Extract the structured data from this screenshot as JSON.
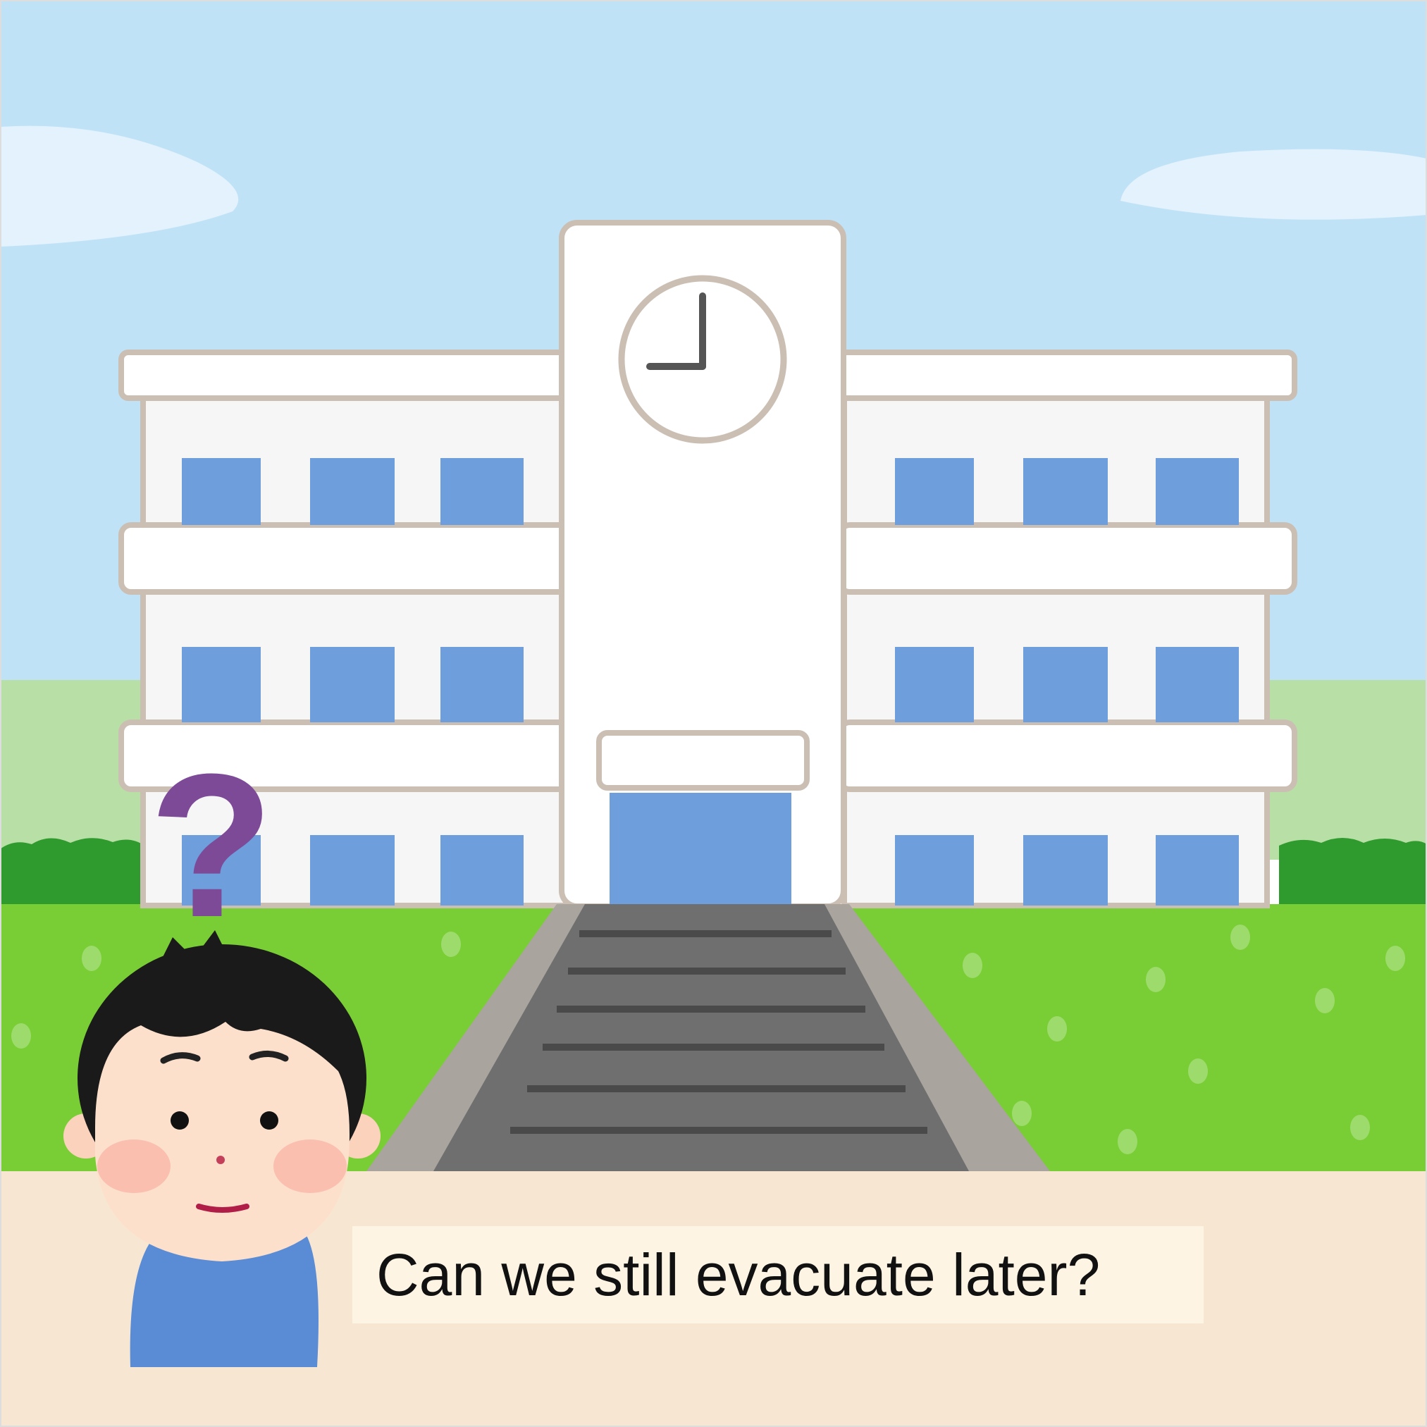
{
  "caption": {
    "text": "Can we still evacuate later?"
  },
  "scene": {
    "building": "school building with clock tower",
    "clock": {
      "hour": 9,
      "minute": 0
    },
    "character": "boy with question mark",
    "question_mark": "?"
  },
  "colors": {
    "sky": "#bfe2f7",
    "cloud": "#e3f2fc",
    "building": "#ffffff",
    "outline": "#cbbfb4",
    "window": "#6e9edb",
    "grass": "#79cd35",
    "hedge": "#2f9a2e",
    "far_field": "#b8e0a6",
    "steps": "#6f6f6f",
    "sand": "#f7e6d2",
    "question_mark": "#7d4a98",
    "shirt": "#5a8cd6",
    "skin": "#fde0cc",
    "hair": "#1a1a1a"
  }
}
